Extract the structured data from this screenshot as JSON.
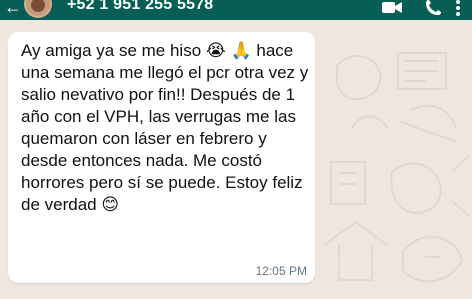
{
  "header": {
    "contact_number": "+52 1 951 255 5578"
  },
  "message": {
    "text": "Ay amiga ya se me hiso 😭 🙏 hace una semana me llegó el pcr otra vez y salio nevativo por fin!! Después de 1 año con el VPH, las verrugas me las quemaron con láser en febrero y desde entonces nada. Me costó horrores pero sí se puede. Estoy feliz de verdad 😊",
    "time": "12:05 PM"
  },
  "icons": {
    "back": "back-arrow-icon",
    "video": "video-call-icon",
    "phone": "phone-call-icon",
    "more": "more-options-icon"
  },
  "colors": {
    "header_bg": "#075e54",
    "chat_bg": "#efe7de",
    "bubble_bg": "#ffffff",
    "timestamp": "#667781"
  }
}
